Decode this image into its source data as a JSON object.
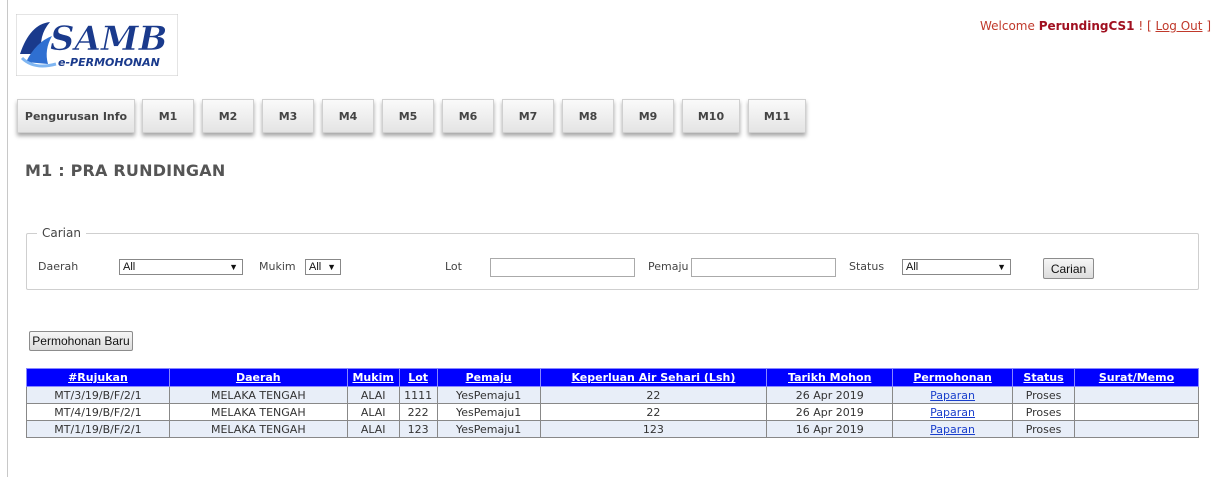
{
  "header": {
    "logo_text": "SAMB",
    "logo_subtext": "e-PERMOHONAN",
    "welcome_prefix": "Welcome",
    "username": "PerundingCS1",
    "separator": "! [",
    "logout_label": "Log Out",
    "close_bracket": "]"
  },
  "nav": {
    "items": [
      "Pengurusan Info",
      "M1",
      "M2",
      "M3",
      "M4",
      "M5",
      "M6",
      "M7",
      "M8",
      "M9",
      "M10",
      "M11"
    ]
  },
  "page": {
    "title": "M1 : PRA RUNDINGAN"
  },
  "search": {
    "legend": "Carian",
    "daerah_label": "Daerah",
    "daerah_value": "All",
    "mukim_label": "Mukim",
    "mukim_value": "All",
    "lot_label": "Lot",
    "lot_value": "",
    "pemaju_label": "Pemaju",
    "pemaju_value": "",
    "status_label": "Status",
    "status_value": "All",
    "button_label": "Carian"
  },
  "actions": {
    "new_label": "Permohonan Baru"
  },
  "table": {
    "headers": [
      "#Rujukan",
      "Daerah",
      "Mukim",
      "Lot",
      "Pemaju",
      "Keperluan Air Sehari (Lsh)",
      "Tarikh Mohon",
      "Permohonan",
      "Status",
      "Surat/Memo"
    ],
    "rows": [
      [
        "MT/3/19/B/F/2/1",
        "MELAKA TENGAH",
        "ALAI",
        "1111",
        "YesPemaju1",
        "22",
        "26 Apr 2019",
        "Paparan",
        "Proses",
        ""
      ],
      [
        "MT/4/19/B/F/2/1",
        "MELAKA TENGAH",
        "ALAI",
        "222",
        "YesPemaju1",
        "22",
        "26 Apr 2019",
        "Paparan",
        "Proses",
        ""
      ],
      [
        "MT/1/19/B/F/2/1",
        "MELAKA TENGAH",
        "ALAI",
        "123",
        "YesPemaju1",
        "123",
        "16 Apr 2019",
        "Paparan",
        "Proses",
        ""
      ]
    ]
  },
  "colors": {
    "header_bg": "#0000ff",
    "row_alt": "#e8eef8",
    "welcome": "#c0392b"
  }
}
